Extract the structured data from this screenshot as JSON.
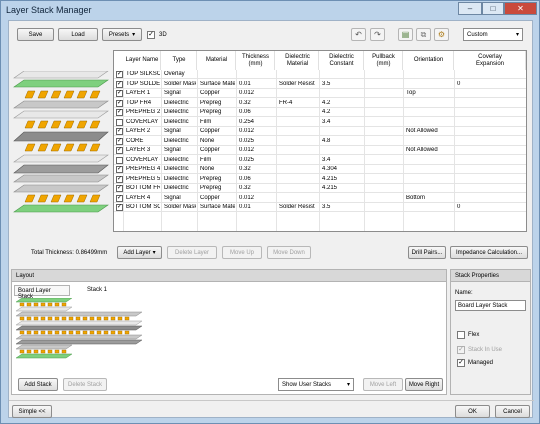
{
  "window": {
    "title": "Layer Stack Manager",
    "minimize": "–",
    "maximize": "□",
    "close": "✕"
  },
  "toolbar": {
    "save": "Save",
    "load": "Load",
    "presets": "Presets",
    "check_3d_label": "3D",
    "check_3d_checked": true,
    "undo_icon": "undo-icon",
    "redo_icon": "redo-icon",
    "preset_value": "Custom"
  },
  "table": {
    "headers": [
      "Layer Name",
      "Type",
      "Material",
      "Thickness\n(mm)",
      "Dielectric\nMaterial",
      "Dielectric\nConstant",
      "Pullback\n(mm)",
      "Orientation",
      "Coverlay\nExpansion"
    ],
    "rows": [
      {
        "checked": true,
        "name": "TOP SILKSCR...",
        "type": "Overlay",
        "material": "",
        "thickness": "",
        "dmat": "",
        "dconst": "",
        "pullback": "",
        "orientation": "",
        "coverlay": ""
      },
      {
        "checked": true,
        "name": "TOP SOLDER...",
        "type": "Solder Mask/...",
        "material": "Surface Mate...",
        "thickness": "0.01",
        "dmat": "Solder Resist",
        "dconst": "3.5",
        "pullback": "",
        "orientation": "",
        "coverlay": "0"
      },
      {
        "checked": true,
        "name": "LAYER 1",
        "type": "Signal",
        "material": "Copper",
        "thickness": "0.012",
        "dmat": "",
        "dconst": "",
        "pullback": "",
        "orientation": "Top",
        "coverlay": ""
      },
      {
        "checked": true,
        "name": "TOP FR4",
        "type": "Dielectric",
        "material": "Prepreg",
        "thickness": "0.32",
        "dmat": "FR-4",
        "dconst": "4.2",
        "pullback": "",
        "orientation": "",
        "coverlay": ""
      },
      {
        "checked": true,
        "name": "PREPREG 2",
        "type": "Dielectric",
        "material": "Prepreg",
        "thickness": "0.06",
        "dmat": "",
        "dconst": "4.2",
        "pullback": "",
        "orientation": "",
        "coverlay": ""
      },
      {
        "checked": false,
        "name": "COVERLAY 2",
        "type": "Dielectric",
        "material": "Film",
        "thickness": "0.254",
        "dmat": "",
        "dconst": "3.4",
        "pullback": "",
        "orientation": "",
        "coverlay": ""
      },
      {
        "checked": true,
        "name": "LAYER 2",
        "type": "Signal",
        "material": "Copper",
        "thickness": "0.012",
        "dmat": "",
        "dconst": "",
        "pullback": "",
        "orientation": "Not Allowed",
        "coverlay": ""
      },
      {
        "checked": true,
        "name": "CORE",
        "type": "Dielectric",
        "material": "None",
        "thickness": "0.025",
        "dmat": "",
        "dconst": "4.8",
        "pullback": "",
        "orientation": "",
        "coverlay": ""
      },
      {
        "checked": true,
        "name": "LAYER 3",
        "type": "Signal",
        "material": "Copper",
        "thickness": "0.012",
        "dmat": "",
        "dconst": "",
        "pullback": "",
        "orientation": "Not Allowed",
        "coverlay": ""
      },
      {
        "checked": false,
        "name": "COVERLAY 4",
        "type": "Dielectric",
        "material": "Film",
        "thickness": "0.025",
        "dmat": "",
        "dconst": "3.4",
        "pullback": "",
        "orientation": "",
        "coverlay": ""
      },
      {
        "checked": true,
        "name": "PREPREG 4",
        "type": "Dielectric",
        "material": "None",
        "thickness": "0.32",
        "dmat": "",
        "dconst": "4.304",
        "pullback": "",
        "orientation": "",
        "coverlay": ""
      },
      {
        "checked": true,
        "name": "PREPREG 5",
        "type": "Dielectric",
        "material": "Prepreg",
        "thickness": "0.06",
        "dmat": "",
        "dconst": "4.215",
        "pullback": "",
        "orientation": "",
        "coverlay": ""
      },
      {
        "checked": true,
        "name": "BOTTOM FR4",
        "type": "Dielectric",
        "material": "Prepreg",
        "thickness": "0.32",
        "dmat": "",
        "dconst": "4.215",
        "pullback": "",
        "orientation": "",
        "coverlay": ""
      },
      {
        "checked": true,
        "name": "LAYER 4",
        "type": "Signal",
        "material": "Copper",
        "thickness": "0.012",
        "dmat": "",
        "dconst": "",
        "pullback": "",
        "orientation": "Bottom",
        "coverlay": ""
      },
      {
        "checked": true,
        "name": "BOTTOM SO...",
        "type": "Solder Mask/...",
        "material": "Surface Mate...",
        "thickness": "0.01",
        "dmat": "Solder Resist",
        "dconst": "3.5",
        "pullback": "",
        "orientation": "",
        "coverlay": "0"
      }
    ]
  },
  "bottom_bar": {
    "total_thickness": "Total Thickness: 0.86499mm",
    "add_layer": "Add Layer",
    "delete_layer": "Delete Layer",
    "move_up": "Move Up",
    "move_down": "Move Down",
    "drill_pairs": "Drill Pairs...",
    "impedance": "Impedance Calculation..."
  },
  "layout": {
    "header": "Layout",
    "tab_board": "Board Layer Stack",
    "tab_stack1": "Stack 1",
    "add_stack": "Add Stack",
    "delete_stack": "Delete Stack",
    "show_stacks": "Show User Stacks",
    "move_left": "Move Left",
    "move_right": "Move Right"
  },
  "stack_properties": {
    "header": "Stack Properties",
    "name_label": "Name:",
    "name_value": "Board Layer Stack",
    "flex": "Flex",
    "stack_in_use": "Stack In Use",
    "managed": "Managed",
    "managed_checked": true
  },
  "footer": {
    "simple": "Simple <<",
    "ok": "OK",
    "cancel": "Cancel"
  },
  "colors": {
    "signal": "#f0a500",
    "dielectric": "#c8c8c8",
    "soldermask": "#7ed07e",
    "overlay": "#e8e8e8",
    "core": "#8c8c8c"
  }
}
